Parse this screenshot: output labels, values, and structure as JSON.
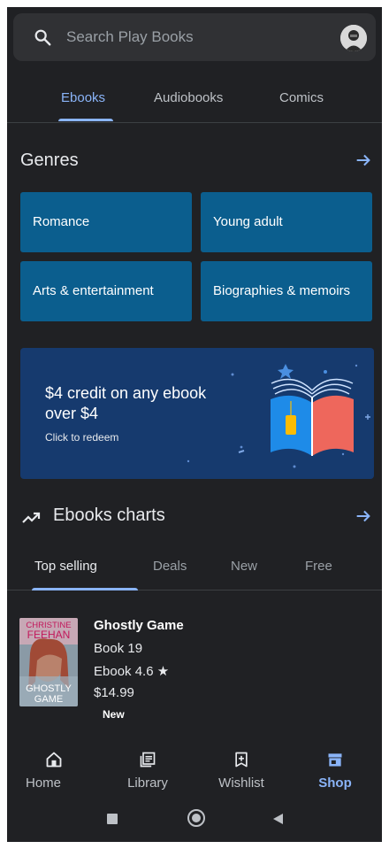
{
  "search": {
    "placeholder": "Search Play Books"
  },
  "tabs": [
    {
      "label": "Ebooks",
      "active": true
    },
    {
      "label": "Audiobooks",
      "active": false
    },
    {
      "label": "Comics",
      "active": false
    }
  ],
  "genres": {
    "title": "Genres",
    "items": [
      "Romance",
      "Young adult",
      "Arts & entertainment",
      "Biographies & memoirs"
    ]
  },
  "promo": {
    "headline": "$4 credit on any ebook over $4",
    "subtext": "Click to redeem"
  },
  "charts": {
    "title": "Ebooks charts",
    "tabs": [
      {
        "label": "Top selling",
        "active": true
      },
      {
        "label": "Deals",
        "active": false
      },
      {
        "label": "New",
        "active": false
      },
      {
        "label": "Free",
        "active": false
      }
    ]
  },
  "book": {
    "cover_author_line1": "CHRISTINE",
    "cover_author_line2": "FEEHAN",
    "cover_title_line1": "GHOSTLY",
    "cover_title_line2": "GAME",
    "title": "Ghostly Game",
    "series": "Book 19",
    "format_rating": "Ebook 4.6 ★",
    "price": "$14.99",
    "badge": "New"
  },
  "bottom_nav": [
    {
      "label": "Home",
      "icon": "home-icon",
      "active": false
    },
    {
      "label": "Library",
      "icon": "library-icon",
      "active": false
    },
    {
      "label": "Wishlist",
      "icon": "wishlist-icon",
      "active": false
    },
    {
      "label": "Shop",
      "icon": "shop-icon",
      "active": true
    }
  ],
  "colors": {
    "background": "#202124",
    "accent": "#8ab4f8",
    "genre_tile": "#0b5e8e",
    "promo_bg": "#163a6e"
  }
}
